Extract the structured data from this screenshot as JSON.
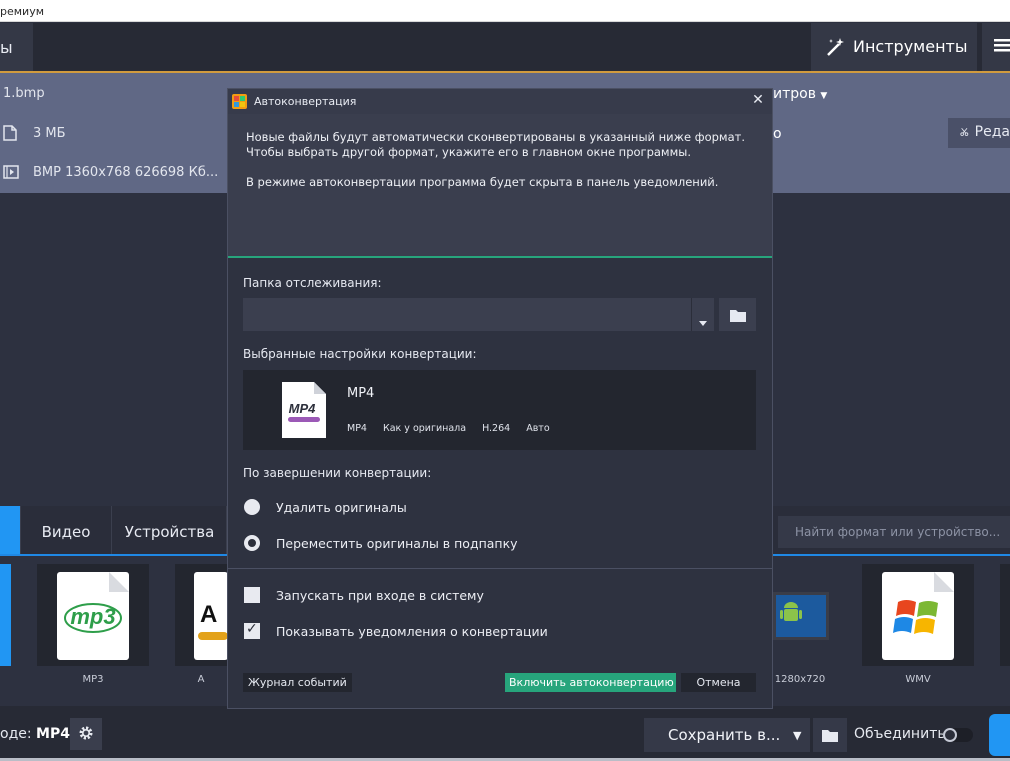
{
  "window": {
    "title": "ремиум"
  },
  "toolbar": {
    "left_button_label": "ы",
    "tools_label": "Инструменты",
    "menu_icon": "hamburger-icon"
  },
  "file": {
    "name": "1.bmp",
    "size": "3 МБ",
    "info": "BMP 1360x768 626698 Кб...",
    "subtitles_label": "итров",
    "audio_label": "о",
    "edit_label": "Реда"
  },
  "formats": {
    "tabs": [
      "Видео",
      "Устройства"
    ],
    "search_placeholder": "Найти формат или устройство...",
    "tiles": [
      {
        "label": "MP3",
        "icon": "mp3-icon"
      },
      {
        "label": "A",
        "icon": "audio-format-icon"
      },
      {
        "label": "- 1280x720",
        "icon": "android-tablet-icon"
      },
      {
        "label": "WMV",
        "icon": "windows-icon"
      }
    ]
  },
  "bottom": {
    "output_prefix": "оде:",
    "output_format": "MP4",
    "save_label": "Сохранить в...",
    "merge_label": "Объединить"
  },
  "dialog": {
    "title": "Автоконвертация",
    "info_paragraph_1": "Новые файлы будут автоматически сконвертированы в указанный ниже формат. Чтобы выбрать другой формат, укажите его в главном окне программы.",
    "info_paragraph_2": "В режиме автоконвертации программа будет скрыта в панель уведомлений.",
    "watch_folder_label": "Папка отслеживания:",
    "watch_folder_value": "",
    "settings_label": "Выбранные настройки конвертации:",
    "preset": {
      "name": "MP4",
      "format": "MP4",
      "resolution": "Как у оригинала",
      "codec": "H.264",
      "audio": "Авто"
    },
    "after_conversion_label": "По завершении конвертации:",
    "options": [
      {
        "label": "Удалить оригиналы",
        "selected": false
      },
      {
        "label": "Переместить оригиналы в подпапку",
        "selected": true
      }
    ],
    "checkboxes": [
      {
        "label": "Запускать при входе в систему",
        "checked": false
      },
      {
        "label": "Показывать уведомления о конвертации",
        "checked": true
      }
    ],
    "buttons": {
      "log": "Журнал событий",
      "enable": "Включить автоконвертацию",
      "cancel": "Отмена"
    }
  }
}
